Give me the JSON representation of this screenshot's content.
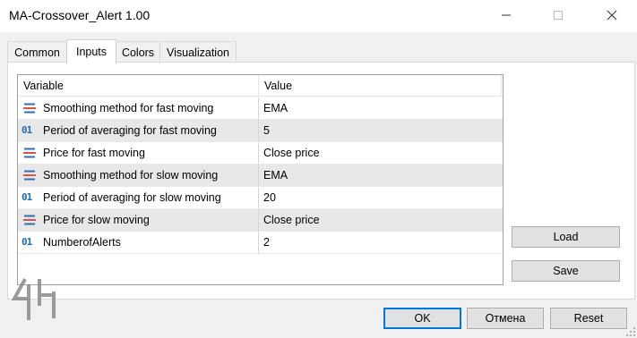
{
  "window": {
    "title": "MA-Crossover_Alert 1.00",
    "minimize_icon": "minimize-icon",
    "maximize_icon": "maximize-icon",
    "close_icon": "close-icon"
  },
  "tabs": [
    {
      "label": "Common",
      "active": false
    },
    {
      "label": "Inputs",
      "active": true
    },
    {
      "label": "Colors",
      "active": false
    },
    {
      "label": "Visualization",
      "active": false
    }
  ],
  "grid": {
    "headers": {
      "variable": "Variable",
      "value": "Value"
    },
    "rows": [
      {
        "icon": "enum-icon",
        "variable": "Smoothing method for fast moving",
        "value": "EMA"
      },
      {
        "icon": "int-icon",
        "icon_text": "01",
        "variable": "Period of averaging for fast moving",
        "value": "5"
      },
      {
        "icon": "enum-icon",
        "variable": "Price for fast moving",
        "value": "Close price"
      },
      {
        "icon": "enum-icon",
        "variable": "Smoothing method for slow moving",
        "value": "EMA"
      },
      {
        "icon": "int-icon",
        "icon_text": "01",
        "variable": "Period of averaging for slow moving",
        "value": "20"
      },
      {
        "icon": "enum-icon",
        "variable": "Price for slow moving",
        "value": "Close price"
      },
      {
        "icon": "int-icon",
        "icon_text": "01",
        "variable": "NumberofAlerts",
        "value": "2"
      }
    ]
  },
  "side_buttons": {
    "load": "Load",
    "save": "Save"
  },
  "footer_buttons": {
    "ok": "OK",
    "cancel": "Отмена",
    "reset": "Reset"
  },
  "colors": {
    "accent": "#0078d7",
    "row_alt": "#e8e8e8",
    "int_icon": "#1e6bb8",
    "enum_icon_red": "#d9534f",
    "enum_icon_blue": "#2f6db5"
  }
}
